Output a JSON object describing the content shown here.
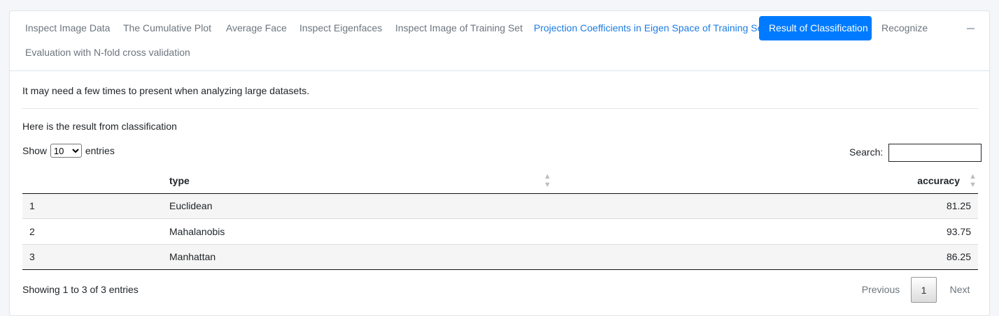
{
  "tabs": [
    {
      "label": "Inspect Image Data",
      "state": "default"
    },
    {
      "label": "The Cumulative Plot",
      "state": "default"
    },
    {
      "label": "Average Face",
      "state": "default"
    },
    {
      "label": "Inspect Eigenfaces",
      "state": "default"
    },
    {
      "label": "Inspect Image of Training Set",
      "state": "default"
    },
    {
      "label": "Projection Coefficients in Eigen Space of Training Set",
      "state": "link"
    },
    {
      "label": "Result of Classification",
      "state": "active"
    },
    {
      "label": "Recognize",
      "state": "default"
    },
    {
      "label": "Evaluation with N-fold cross validation",
      "state": "default"
    }
  ],
  "note": "It may need a few times to present when analyzing large datasets.",
  "caption": "Here is the result from classification",
  "length": {
    "prefix": "Show",
    "value": "10",
    "suffix": "entries"
  },
  "search": {
    "label": "Search:",
    "value": ""
  },
  "table": {
    "headers": {
      "index": "",
      "type": "type",
      "accuracy": "accuracy"
    },
    "rows": [
      {
        "index": "1",
        "type": "Euclidean",
        "accuracy": "81.25"
      },
      {
        "index": "2",
        "type": "Mahalanobis",
        "accuracy": "93.75"
      },
      {
        "index": "3",
        "type": "Manhattan",
        "accuracy": "86.25"
      }
    ]
  },
  "info": "Showing 1 to 3 of 3 entries",
  "pagination": {
    "previous": "Previous",
    "current": "1",
    "next": "Next"
  },
  "colors": {
    "accent": "#007bff",
    "link": "#1d7ce4",
    "muted": "#6c757d"
  }
}
